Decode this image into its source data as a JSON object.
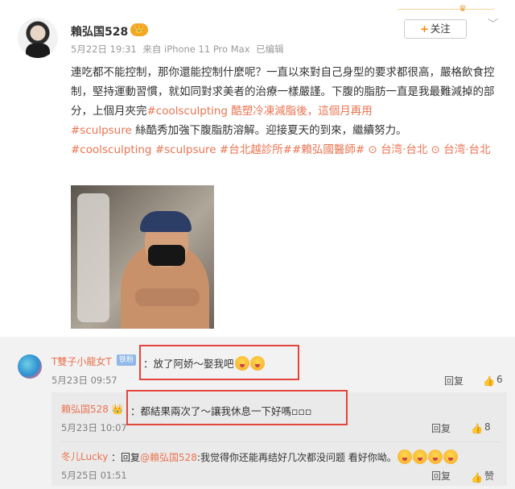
{
  "post": {
    "username": "賴弘国528",
    "vip_badge": "👑",
    "date": "5月22日 19:31",
    "source": "来自 iPhone 11 Pro Max",
    "edited": "已编辑",
    "follow_label": "关注",
    "text_1": "連吃都不能控制，那你還能控制什麼呢？一直以來對自己身型的要求都很高，嚴格飲食控制，堅持運動習慣，就如同對求美者的治療一樣嚴謹。下腹的脂肪一直是我最難減掉的部分，上個月夾完",
    "tag_coolsculpting_1": "#coolsculpting 酷塑冷凍減脂後，這個月再用",
    "tag_sculpsure": "#sculpsure",
    "text_2": "絲酷秀加強下腹脂肪溶解。迎接夏天的到來，繼續努力。",
    "tag_coolsculpting_2": "#coolsculpting",
    "tag_sculpsure_2": "#sculpsure",
    "tag_clinic": "#台北越診所#",
    "tag_doctor": "#賴弘國醫師#",
    "location_1": "台湾·台北",
    "location_2": "台湾·台北"
  },
  "comments": [
    {
      "name": "T雙子小龍女T",
      "fan_badge": "铁粉",
      "text": "：放了阿娇～娶我吧",
      "time": "5月23日 09:57",
      "reply_label": "回复",
      "likes": "6"
    },
    {
      "name": "賴弘国528",
      "text": "：都結果兩次了～讓我休息一下好嗎▫▫▫",
      "time": "5月23日 10:07",
      "reply_label": "回复",
      "likes": "8"
    },
    {
      "name": "冬儿Lucky",
      "text_prefix": "：回复",
      "mention": "@賴弘国528",
      "text": ":我觉得你还能再结好几次都没问题 看好你呦。",
      "time": "5月25日 01:51",
      "reply_label": "回复",
      "likes_label": "赞"
    }
  ],
  "colors": {
    "accent": "#eb7350",
    "highlight_box": "#e2453b",
    "comment_bg": "#f2f2f2"
  },
  "icons": {
    "follow": "plus-icon",
    "menu": "chevron-down-icon",
    "like": "thumbs-up-icon",
    "location": "location-pin-icon"
  }
}
